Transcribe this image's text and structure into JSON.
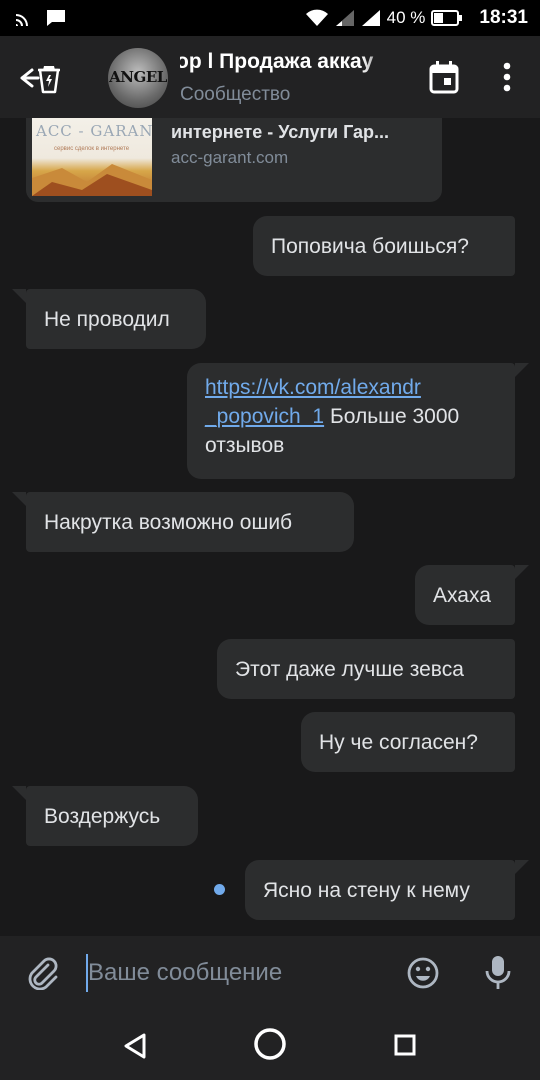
{
  "status_bar": {
    "battery_percent": "40 %",
    "time": "18:31",
    "icons": [
      "cast-icon",
      "message-notification-icon",
      "wifi-icon",
      "signal-weak-icon",
      "signal-full-icon",
      "battery-icon"
    ]
  },
  "header": {
    "title": "ор l Продажа аккау",
    "subtitle": "Сообщество",
    "avatar_text": "ANGEL",
    "icons": {
      "back": "back-arrow-icon",
      "calendar": "calendar-icon",
      "more": "more-vertical-icon"
    }
  },
  "link_preview": {
    "title": "интернете - Услуги Гар...",
    "domain": "acc-garant.com",
    "thumb_brand": "ACC - GARANT",
    "thumb_tag": "сервис сделок в интернете"
  },
  "messages": [
    {
      "direction": "out",
      "text": "Поповича боишься?"
    },
    {
      "direction": "in",
      "text": "Не проводил"
    },
    {
      "direction": "out",
      "link": "https://vk.com/alexandr_popovich_1",
      "link_line1": "https://vk.com/alexandr",
      "link_line2": "_popovich_1",
      "text_after_link": " Больше 3000",
      "text_line3": "отзывов"
    },
    {
      "direction": "in",
      "text": "Накрутка возможно ошиб"
    },
    {
      "direction": "out",
      "text": "Ахаха"
    },
    {
      "direction": "out",
      "text": "Этот даже лучше зевса"
    },
    {
      "direction": "out",
      "text": "Ну че согласен?"
    },
    {
      "direction": "in",
      "text": "Воздержусь"
    },
    {
      "direction": "out",
      "text": "Ясно на стену к нему",
      "unread": true
    }
  ],
  "composer": {
    "placeholder": "Ваше сообщение",
    "value": "",
    "icons": {
      "attach": "paperclip-icon",
      "emoji": "emoji-icon",
      "mic": "microphone-icon"
    }
  },
  "nav_bar": {
    "icons": [
      "nav-back-icon",
      "nav-home-icon",
      "nav-recents-icon"
    ]
  },
  "colors": {
    "background": "#19191a",
    "bubble": "#2c2d2e",
    "bar": "#222223",
    "link": "#71aaeb",
    "secondary_text": "#818c99"
  }
}
